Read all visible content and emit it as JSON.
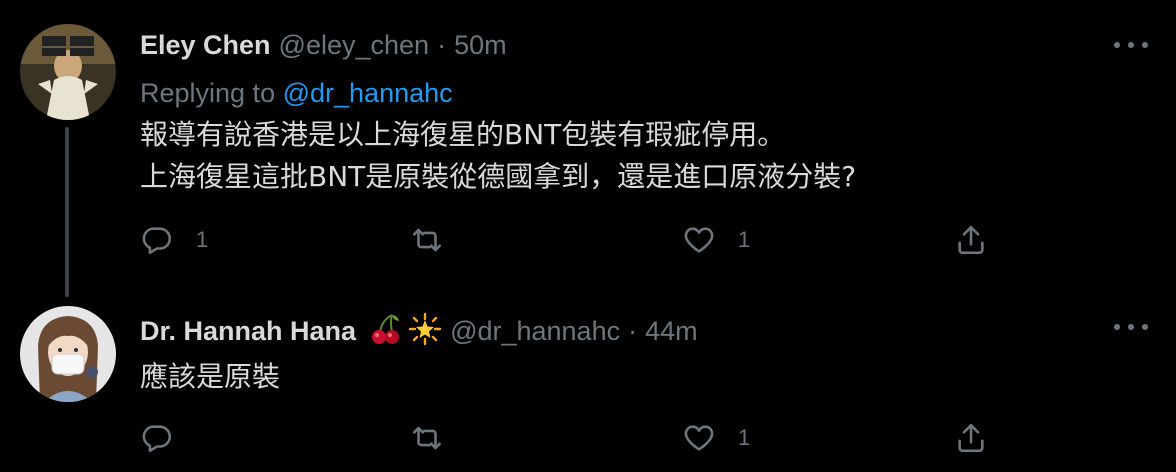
{
  "tweets": [
    {
      "display_name": "Eley Chen",
      "handle": "@eley_chen",
      "separator": "·",
      "time": "50m",
      "replying_prefix": "Replying to",
      "replying_to": "@dr_hannahc",
      "lines": [
        "報導有說香港是以上海復星的BNT包裝有瑕疵停用。",
        "上海復星這批BNT是原裝從德國拿到，還是進口原液分裝?"
      ],
      "reply_count": "1",
      "retweet_count": "",
      "like_count": "1"
    },
    {
      "display_name": "Dr. Hannah Hana",
      "name_emojis": [
        "cherries-icon",
        "glowing-star-icon"
      ],
      "handle": "@dr_hannahc",
      "separator": "·",
      "time": "44m",
      "lines": [
        "應該是原裝"
      ],
      "reply_count": "",
      "retweet_count": "",
      "like_count": "1"
    }
  ],
  "colors": {
    "background": "#000000",
    "text": "#d9d9d9",
    "muted": "#6e767d",
    "link": "#1d9bf0",
    "thread_line": "#3d4147"
  }
}
